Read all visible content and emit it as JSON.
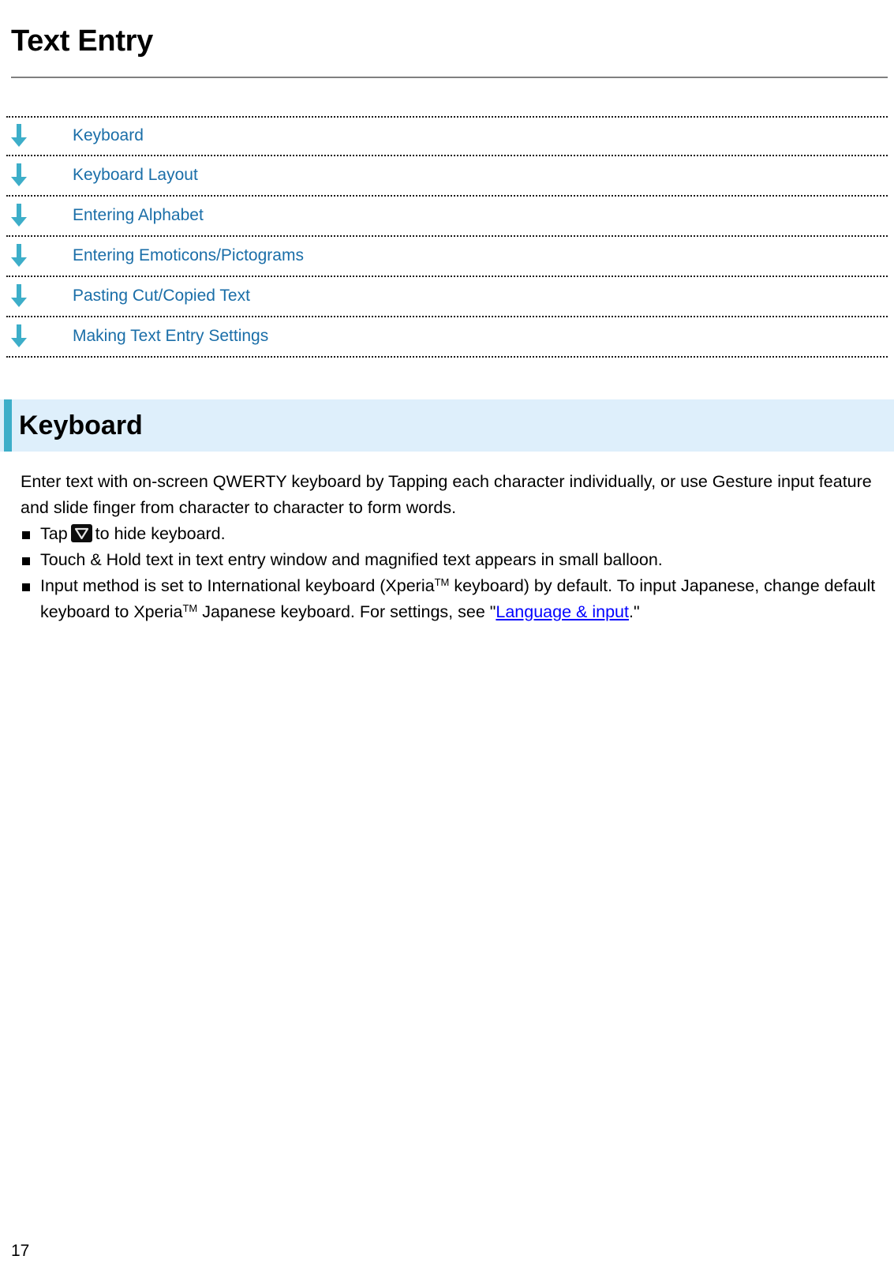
{
  "document": {
    "title": "Text Entry",
    "page_number": "17"
  },
  "toc": {
    "items": [
      {
        "label": "Keyboard",
        "icon": "down-arrow-icon"
      },
      {
        "label": "Keyboard Layout",
        "icon": "down-arrow-icon"
      },
      {
        "label": "Entering Alphabet",
        "icon": "down-arrow-icon"
      },
      {
        "label": "Entering Emoticons/Pictograms",
        "icon": "down-arrow-icon"
      },
      {
        "label": "Pasting Cut/Copied Text",
        "icon": "down-arrow-icon"
      },
      {
        "label": "Making Text Entry Settings",
        "icon": "down-arrow-icon"
      }
    ]
  },
  "section": {
    "heading": "Keyboard",
    "intro": "Enter text with on-screen QWERTY keyboard by Tapping each character individually, or use Gesture input feature and slide finger from character to character to form words.",
    "bullets": [
      {
        "id": "tap-hide-keyboard",
        "text_before_icon": "Tap",
        "icon": "hide-keyboard-icon",
        "text_after_icon": "to hide keyboard."
      },
      {
        "id": "touch-and-hold",
        "text": "Touch & Hold text in text entry window and magnified text appears in small balloon."
      },
      {
        "id": "input-method-default",
        "segment_1": "Input method is set to International keyboard (Xperia",
        "sup_1": "TM",
        "segment_2": " keyboard) by default. To input Japanese, change default keyboard to Xperia",
        "sup_2": "TM",
        "segment_3": " Japanese keyboard. For settings, see \"",
        "link_label": "Language & input",
        "segment_4": ".\""
      }
    ]
  },
  "colors": {
    "accent_teal": "#3daec9",
    "section_background": "#deeffb",
    "toc_link": "#1a6ea8",
    "inline_link": "#0000ff",
    "rule_gray": "#808080"
  }
}
